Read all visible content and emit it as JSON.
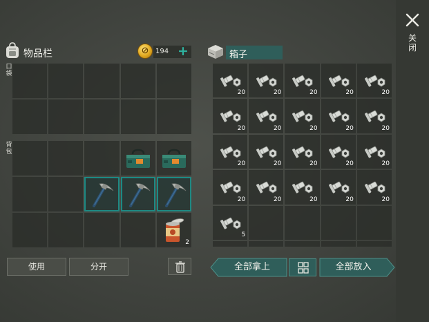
{
  "close": {
    "label": "关闭",
    "icon": "close-icon"
  },
  "inventory": {
    "title": "物品栏",
    "coins": "194",
    "coin_symbol": "⊘",
    "plus": "+",
    "pocket_label": "口袋",
    "backpack_label": "背包",
    "backpack": [
      {
        "item": null
      },
      {
        "item": null
      },
      {
        "item": null
      },
      {
        "item": "toolbox",
        "qty": ""
      },
      {
        "item": "toolbox",
        "qty": ""
      },
      {
        "item": null
      },
      {
        "item": null
      },
      {
        "item": "pickaxe",
        "qty": "",
        "selected": true
      },
      {
        "item": "pickaxe",
        "qty": "",
        "selected": true
      },
      {
        "item": "pickaxe",
        "qty": "",
        "selected": true
      },
      {
        "item": null
      },
      {
        "item": null
      },
      {
        "item": null
      },
      {
        "item": null
      },
      {
        "item": "can",
        "qty": "2"
      }
    ]
  },
  "box": {
    "name": "箱子",
    "slots": [
      {
        "item": "nails",
        "qty": "20"
      },
      {
        "item": "nails",
        "qty": "20"
      },
      {
        "item": "nails",
        "qty": "20"
      },
      {
        "item": "nails",
        "qty": "20"
      },
      {
        "item": "nails",
        "qty": "20"
      },
      {
        "item": "nails",
        "qty": "20"
      },
      {
        "item": "nails",
        "qty": "20"
      },
      {
        "item": "nails",
        "qty": "20"
      },
      {
        "item": "nails",
        "qty": "20"
      },
      {
        "item": "nails",
        "qty": "20"
      },
      {
        "item": "nails",
        "qty": "20"
      },
      {
        "item": "nails",
        "qty": "20"
      },
      {
        "item": "nails",
        "qty": "20"
      },
      {
        "item": "nails",
        "qty": "20"
      },
      {
        "item": "nails",
        "qty": "20"
      },
      {
        "item": "nails",
        "qty": "20"
      },
      {
        "item": "nails",
        "qty": "20"
      },
      {
        "item": "nails",
        "qty": "20"
      },
      {
        "item": "nails",
        "qty": "20"
      },
      {
        "item": "nails",
        "qty": "20"
      },
      {
        "item": "nails",
        "qty": "5"
      },
      {
        "item": null
      },
      {
        "item": null
      },
      {
        "item": null
      },
      {
        "item": null
      }
    ]
  },
  "actions": {
    "use": "使用",
    "split": "分开",
    "trash_icon": "trash-icon",
    "take_all": "全部拿上",
    "put_all": "全部放入",
    "sort_icon": "sort-icon"
  },
  "colors": {
    "accent": "#2eb3a0",
    "teal_dark": "#2f5e5a",
    "slot": "#2a2d28",
    "coin": "#e1a920"
  }
}
